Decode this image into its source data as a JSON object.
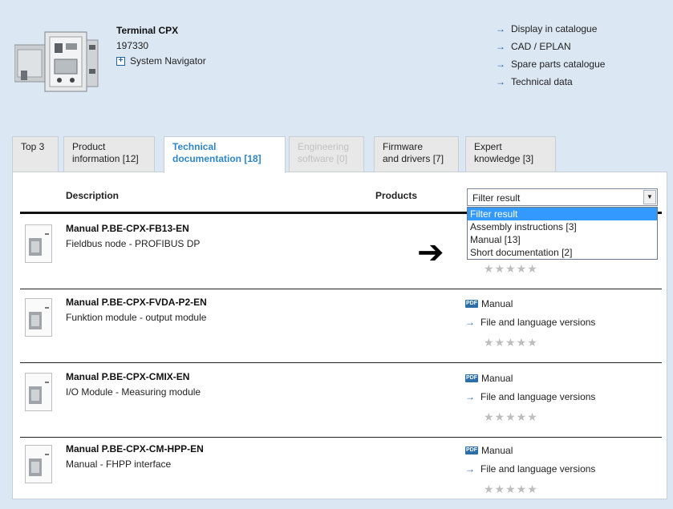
{
  "product": {
    "title": "Terminal CPX",
    "number": "197330",
    "system_navigator": "System Navigator"
  },
  "links": [
    "Display in catalogue",
    "CAD / EPLAN",
    "Spare parts catalogue",
    "Technical data"
  ],
  "tabs": [
    {
      "line1": "Top 3",
      "line2": ""
    },
    {
      "line1": "Product",
      "line2": "information [12]"
    },
    {
      "line1": "Technical",
      "line2": "documentation [18]"
    },
    {
      "line1": "Engineering",
      "line2": "software [0]"
    },
    {
      "line1": "Firmware",
      "line2": "and drivers [7]"
    },
    {
      "line1": "Expert",
      "line2": "knowledge [3]"
    }
  ],
  "table": {
    "col_description": "Description",
    "col_products": "Products"
  },
  "filter": {
    "selected": "Filter result",
    "options": [
      "Filter result",
      "Assembly instructions [3]",
      "Manual [13]",
      "Short documentation [2]"
    ]
  },
  "documents": [
    {
      "title": "Manual P.BE-CPX-FB13-EN",
      "subtitle": "Fieldbus node - PROFIBUS DP",
      "type": "",
      "files": ""
    },
    {
      "title": "Manual P.BE-CPX-FVDA-P2-EN",
      "subtitle": "Funktion module - output module",
      "type": "Manual",
      "files": "File and language versions"
    },
    {
      "title": "Manual P.BE-CPX-CMIX-EN",
      "subtitle": "I/O Module - Measuring module",
      "type": "Manual",
      "files": "File and language versions"
    },
    {
      "title": "Manual P.BE-CPX-CM-HPP-EN",
      "subtitle": "Manual - FHPP interface",
      "type": "Manual",
      "files": "File and language versions"
    }
  ],
  "rating_stars": "★★★★★",
  "pdf_label": "PDF",
  "arrow_glyph": "→",
  "colors": {
    "background": "#dbe7f3",
    "accent_link": "#1f63a8",
    "active_tab_text": "#2f86c7",
    "dropdown_highlight": "#3399ff"
  }
}
